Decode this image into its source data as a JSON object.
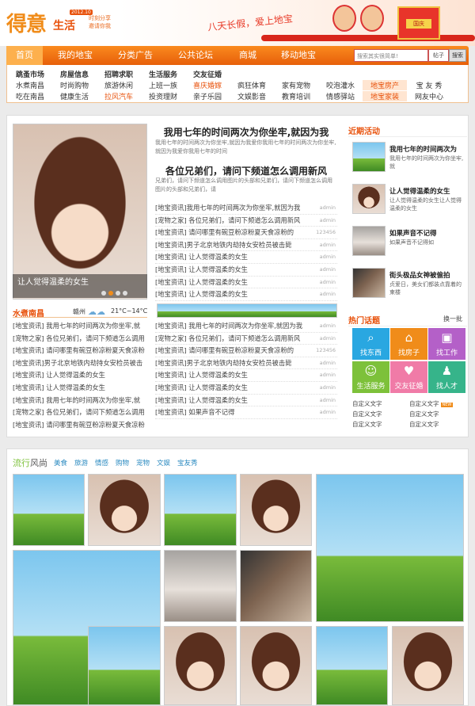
{
  "header": {
    "logo_main": "得意",
    "logo_sub": "生活",
    "logo_date": "2012.10",
    "logo_tag1": "时刻分享",
    "logo_tag2": "邀请你我",
    "slogan": "八天长假，爱上地宝",
    "badge": "国庆"
  },
  "nav": {
    "items": [
      "首页",
      "我的地宝",
      "分类广告",
      "公共论坛",
      "商城",
      "移动地宝"
    ],
    "search_placeholder": "搜索其实很简单!",
    "search_scope": "帖子",
    "search_button": "搜索"
  },
  "subnav": {
    "cols": [
      {
        "head": "跳蚤市场",
        "a": "水煮南昌",
        "b": "吃在南昌"
      },
      {
        "head": "房屋信息",
        "a": "时尚购物",
        "b": "健康生活"
      },
      {
        "head": "招聘求职",
        "a": "旅游休闲",
        "b": "拉风汽车"
      },
      {
        "head": "生活服务",
        "a": "上班一族",
        "b": "投资理财"
      },
      {
        "head": "交友征婚",
        "a": "喜庆婚嫁",
        "b": "亲子乐园"
      },
      {
        "head": "",
        "a": "疯狂体育",
        "b": "文娱影音"
      },
      {
        "head": "",
        "a": "家有宠物",
        "b": "教育培训"
      },
      {
        "head": "",
        "a": "咬泡灌水",
        "b": "情感驿站"
      },
      {
        "head": "",
        "a": "地宝房产",
        "b": "地宝家装"
      },
      {
        "head": "",
        "a": "宝 友 秀",
        "b": "网友中心"
      }
    ]
  },
  "slider": {
    "caption": "让人觉得温柔的女生"
  },
  "headlines": [
    {
      "title": "我用七年的时间两次为你坐牢,就因为我",
      "desc": "我用七年的时间两次为你坐牢,就因为我爱你我用七年的时间两次为你坐牢,就因为我爱你我用七年的时间"
    },
    {
      "title": "各位兄弟们，请问下频道怎么调用新风",
      "desc": "兄弟们，请问下频道怎么调用图片的头部和兄弟们，请问下频道怎么调用图片的头部和兄弟们，请"
    }
  ],
  "list_top": [
    {
      "t": "[地宝资讯]我用七年的时间两次为你坐牢,就因为我",
      "u": "admin"
    },
    {
      "t": "[宠物之家] 各位兄弟们，请问下频道怎么调用新风",
      "u": "admin"
    },
    {
      "t": "[地宝资讯] 请问哪里有碗豆粉凉粉夏天食凉粉的",
      "u": "123456"
    },
    {
      "t": "[地宝资讯]男子北京地铁内劫持女安检员被击毙",
      "u": "admin"
    },
    {
      "t": "[地宝资讯] 让人觉得温柔的女生",
      "u": "admin"
    },
    {
      "t": "[地宝资讯] 让人觉得温柔的女生",
      "u": "admin"
    },
    {
      "t": "[地宝资讯] 让人觉得温柔的女生",
      "u": "admin"
    },
    {
      "t": "[地宝资讯] 让人觉得温柔的女生",
      "u": "admin"
    }
  ],
  "local": {
    "title": "水煮南昌",
    "city": "赣州",
    "temp": "21°C~14°C"
  },
  "list_left": [
    "[地宝资讯] 我用七年的时间两次为你坐牢,就",
    "[宠物之家] 各位兄弟们，请问下频道怎么调用",
    "[地宝资讯] 请问哪里有碗豆粉凉粉夏天食凉粉",
    "[地宝资讯]男子北京地铁内劫持女安检员被击",
    "[地宝资讯] 让人觉得温柔的女生",
    "[地宝资讯] 让人觉得温柔的女生",
    "[地宝资讯] 我用七年的时间两次为你坐牢,就",
    "[宠物之家] 各位兄弟们，请问下频道怎么调用",
    "[地宝资讯] 请问哪里有碗豆粉凉粉夏天食凉粉"
  ],
  "list_mid": [
    {
      "t": "[地宝资讯] 我用七年的时间两次为你坐牢,就因为我",
      "u": "admin"
    },
    {
      "t": "[宠物之家] 各位兄弟们，请问下频道怎么调用新风",
      "u": "admin"
    },
    {
      "t": "[地宝资讯] 请问哪里有碗豆粉凉粉夏天食凉粉的",
      "u": "123456"
    },
    {
      "t": "[地宝资讯]男子北京地铁内劫持女安检员被击毙",
      "u": "admin"
    },
    {
      "t": "[地宝资讯] 让人觉得温柔的女生",
      "u": "admin"
    },
    {
      "t": "[地宝资讯] 让人觉得温柔的女生",
      "u": "admin"
    },
    {
      "t": "[地宝资讯] 让人觉得温柔的女生",
      "u": "admin"
    },
    {
      "t": "[地宝资讯] 如果声音不记得",
      "u": "admin"
    }
  ],
  "activity": {
    "title": "近期活动",
    "items": [
      {
        "t": "我用七年的时间两次为",
        "d": "我用七年的时间两次为你坐牢,就"
      },
      {
        "t": "让人觉得温柔的女生",
        "d": "让人觉得温柔的女生让人觉得温柔的女生"
      },
      {
        "t": "如果声音不记得",
        "d": "如果声音不记得如"
      },
      {
        "t": "街头极品女神被偷拍",
        "d": "贞爱日，美女们都装点靠着的柬楼"
      }
    ]
  },
  "hot": {
    "title": "热门话题",
    "refresh": "换一批",
    "tiles": [
      "找东西",
      "找房子",
      "找工作",
      "生活服务",
      "交友征婚",
      "找人才"
    ],
    "tile_colors": [
      "#29a7e1",
      "#f08c1a",
      "#b460c8",
      "#7dc13a",
      "#f07ba7",
      "#36b48a"
    ],
    "custom": [
      "自定义文字",
      "自定义文字",
      "自定义文字",
      "自定义文字",
      "自定义文字",
      "自定义文字"
    ],
    "new": "NEW"
  },
  "fashion": {
    "title_a": "流行",
    "title_b": "风尚",
    "tags": [
      "美食",
      "旅游",
      "情感",
      "购物",
      "宠物",
      "文娱",
      "宝友秀"
    ]
  }
}
